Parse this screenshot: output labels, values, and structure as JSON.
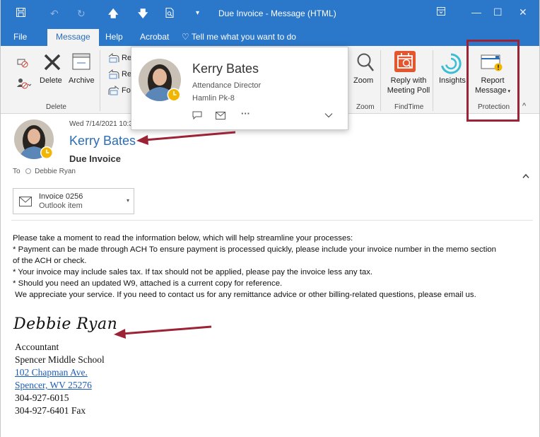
{
  "window": {
    "title": "Due Invoice  -  Message (HTML)"
  },
  "tabs": {
    "file": "File",
    "message": "Message",
    "help": "Help",
    "acrobat": "Acrobat",
    "tell_me": "Tell me what you want to do"
  },
  "ribbon": {
    "delete_label": "Delete",
    "archive_label": "Archive",
    "delete_group": "Delete",
    "reply_partial": "Re",
    "reply_all_partial": "Re",
    "forward_partial": "Fo",
    "zoom_label": "Zoom",
    "zoom_group": "Zoom",
    "reply_poll_label_1": "Reply with",
    "reply_poll_label_2": "Meeting Poll",
    "findtime_group": "FindTime",
    "insights_label": "Insights",
    "report_label_1": "Report",
    "report_label_2": "Message",
    "protection_group": "Protection"
  },
  "contact_card": {
    "name": "Kerry Bates",
    "role": "Attendance Director",
    "organization": "Hamlin Pk-8"
  },
  "message": {
    "date": "Wed 7/14/2021 10:36",
    "sender": "Kerry Bates",
    "subject": "Due Invoice",
    "to_label": "To",
    "to_name": "Debbie Ryan"
  },
  "attachment": {
    "name": "Invoice 0256",
    "type": "Outlook item"
  },
  "body": {
    "line1": "Please take a moment to read the information below, which will help streamline your processes:",
    "line2": "* Payment can be made through ACH To ensure payment is processed quickly, please include your invoice number in the memo section",
    "line3": "of the ACH or check.",
    "line4": "* Your invoice may include sales tax. If tax should not be applied, please pay the invoice less any tax.",
    "line5": "* Should you need an updated W9, attached is a current copy for reference.",
    "line6": " We appreciate your service. If you need to contact us for any remittance advice or other billing-related questions, please email us."
  },
  "signature": {
    "script_name": "Debbie Ryan",
    "title": "Accountant",
    "school": "Spencer Middle School",
    "address1": "102 Chapman Ave.",
    "address2": "Spencer, WV 25276",
    "phone": "304-927-6015",
    "fax": "304-927-6401 Fax"
  },
  "colors": {
    "title_bar": "#2b77c9",
    "accent_blue": "#2b6cb8",
    "highlight_box": "#9b2335",
    "arrow": "#9b2335",
    "presence_away": "#f2b600"
  }
}
